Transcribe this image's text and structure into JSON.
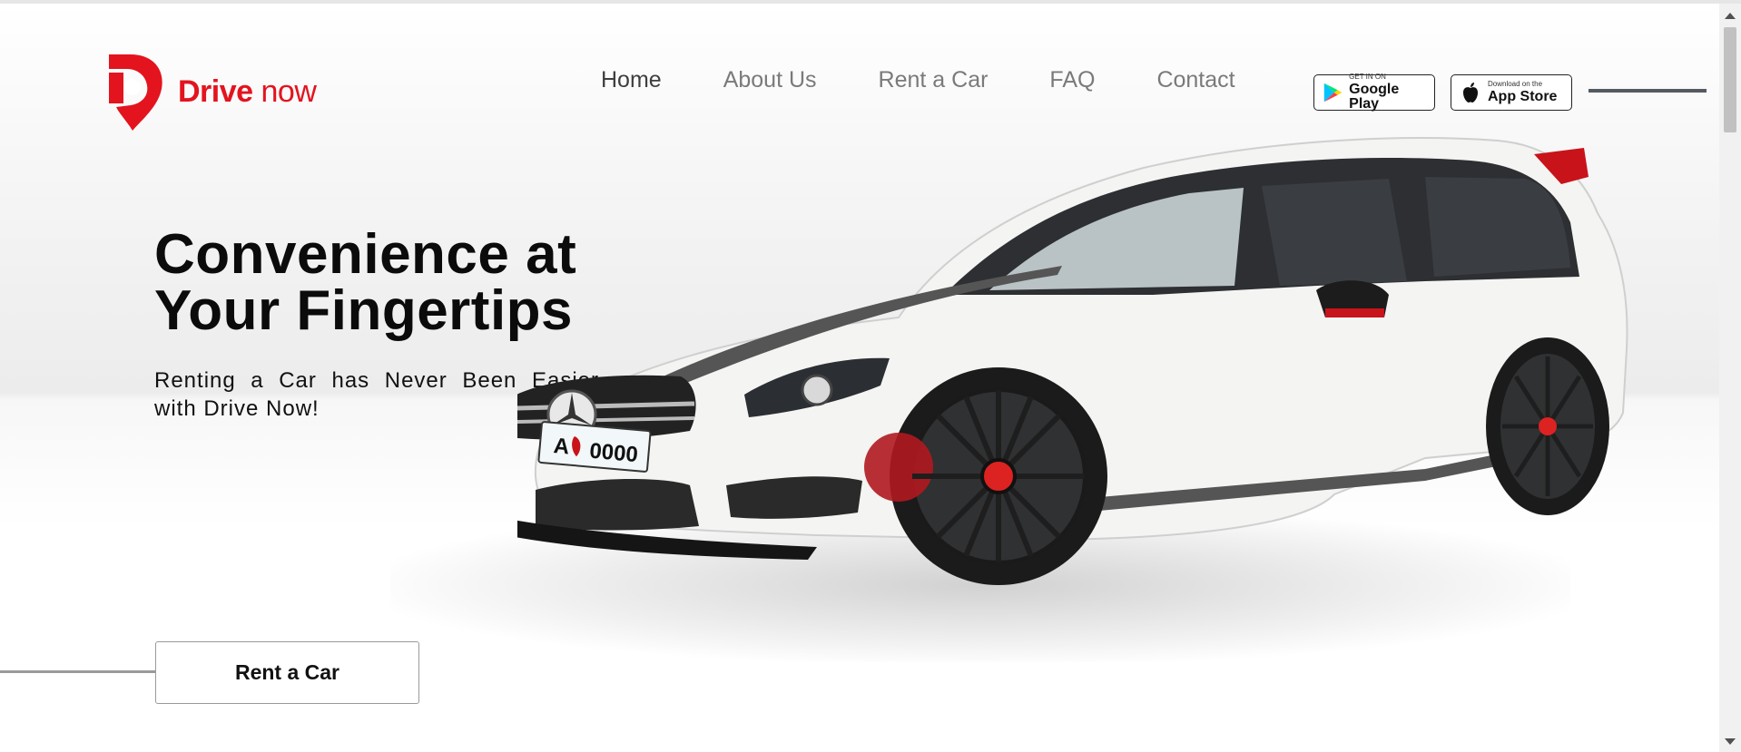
{
  "brand": {
    "name_part1": "Drive",
    "name_part2": "now",
    "color": "#e3141e"
  },
  "nav": {
    "items": [
      {
        "label": "Home",
        "active": true
      },
      {
        "label": "About Us",
        "active": false
      },
      {
        "label": "Rent a Car",
        "active": false
      },
      {
        "label": "FAQ",
        "active": false
      },
      {
        "label": "Contact",
        "active": false
      }
    ]
  },
  "badges": {
    "google_play": {
      "small": "GET IN ON",
      "big": "Google Play",
      "icon": "google-play-icon"
    },
    "app_store": {
      "small": "Download on the",
      "big": "App Store",
      "icon": "apple-icon"
    }
  },
  "hero": {
    "title_line1": "Convenience at",
    "title_line2": "Your Fingertips",
    "subtitle": "Renting a Car has Never Been Easier with Drive Now!",
    "cta_label": "Rent a Car",
    "plate_letter": "A",
    "plate_number": "0000"
  }
}
